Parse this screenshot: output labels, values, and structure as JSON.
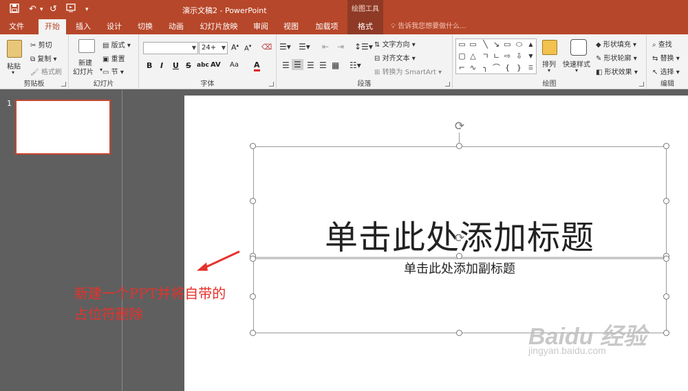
{
  "titlebar": {
    "title": "演示文稿2 - PowerPoint",
    "context_group": "绘图工具",
    "save_icon": "save-icon",
    "undo_icon": "undo-icon",
    "redo_icon": "redo-icon",
    "present_icon": "from-beginning-icon",
    "customize_icon": "customize-qat-icon"
  },
  "tabs": [
    "文件",
    "开始",
    "插入",
    "设计",
    "切换",
    "动画",
    "幻灯片放映",
    "审阅",
    "视图",
    "加载项",
    "格式"
  ],
  "active_tab": "开始",
  "tell_me": "告诉我您想要做什么...",
  "ribbon": {
    "clipboard": {
      "label": "剪贴板",
      "paste": "粘贴",
      "cut": "剪切",
      "copy": "复制",
      "format_painter": "格式刷"
    },
    "slides": {
      "label": "幻灯片",
      "new_slide": "新建",
      "new_slide2": "幻灯片",
      "layout": "版式",
      "reset": "重置",
      "section": "节"
    },
    "font": {
      "label": "字体",
      "font_name": "",
      "font_size": "24+",
      "bold": "B",
      "italic": "I",
      "underline": "U",
      "strike": "S",
      "shadow": "abc",
      "spacing": "AV",
      "case": "Aa",
      "color": "A"
    },
    "paragraph": {
      "label": "段落",
      "text_direction": "文字方向",
      "align_text": "对齐文本",
      "smartart": "转换为 SmartArt"
    },
    "drawing": {
      "label": "绘图",
      "arrange": "排列",
      "quick_styles": "快速样式",
      "shape_fill": "形状填充",
      "shape_outline": "形状轮廓",
      "shape_effects": "形状效果"
    },
    "editing": {
      "label": "编辑",
      "find": "查找",
      "replace": "替换",
      "select": "选择"
    }
  },
  "thumbnail_number": "1",
  "slide": {
    "title_placeholder": "单击此处添加标题",
    "subtitle_placeholder": "单击此处添加副标题"
  },
  "annotation": {
    "line1": "新建一个PPT并将自带的",
    "line2": "占位符删除"
  },
  "watermark": {
    "logo": "Baidu 经验",
    "url": "jingyan.baidu.com"
  },
  "colors": {
    "brand": "#b7472a",
    "annotation": "#e5322b",
    "selection": "#c8472e"
  }
}
